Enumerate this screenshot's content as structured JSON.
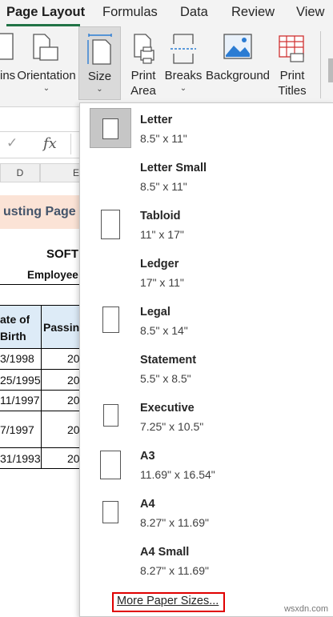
{
  "tabs": [
    {
      "label": "Page Layout",
      "active": true
    },
    {
      "label": "Formulas",
      "active": false
    },
    {
      "label": "Data",
      "active": false
    },
    {
      "label": "Review",
      "active": false
    },
    {
      "label": "View",
      "active": false
    }
  ],
  "ribbon": {
    "margins": {
      "label": "ins"
    },
    "orientation": {
      "label": "Orientation"
    },
    "size": {
      "label": "Size"
    },
    "print_area": {
      "line1": "Print",
      "line2": "Area"
    },
    "breaks": {
      "label": "Breaks"
    },
    "background": {
      "label": "Background"
    },
    "print_titles": {
      "line1": "Print",
      "line2": "Titles"
    }
  },
  "formula_bar": {
    "fx": "fx",
    "check": "✓"
  },
  "sheet": {
    "columns": [
      "D",
      "E"
    ],
    "title_partial": "usting Page S",
    "soft_partial": "SOFT",
    "employee_partial": "Employee",
    "header_date_line1": "ate of",
    "header_date_line2": "Birth",
    "header_passing_partial": "Passing",
    "rows": [
      {
        "date": "3/1998",
        "other": "20"
      },
      {
        "date": "25/1995",
        "other": "20"
      },
      {
        "date": "11/1997",
        "other": "20"
      },
      {
        "date": "7/1997",
        "other": "20"
      },
      {
        "date": "31/1993",
        "other": "20"
      }
    ]
  },
  "paper_sizes": [
    {
      "name": "Letter",
      "dims": "8.5\" x 11\"",
      "selected": true
    },
    {
      "name": "Letter Small",
      "dims": "8.5\" x 11\"",
      "selected": false
    },
    {
      "name": "Tabloid",
      "dims": "11\" x 17\"",
      "selected": false
    },
    {
      "name": "Ledger",
      "dims": "17\" x 11\"",
      "selected": false
    },
    {
      "name": "Legal",
      "dims": "8.5\" x 14\"",
      "selected": false
    },
    {
      "name": "Statement",
      "dims": "5.5\" x 8.5\"",
      "selected": false
    },
    {
      "name": "Executive",
      "dims": "7.25\" x 10.5\"",
      "selected": false
    },
    {
      "name": "A3",
      "dims": "11.69\" x 16.54\"",
      "selected": false
    },
    {
      "name": "A4",
      "dims": "8.27\" x 11.69\"",
      "selected": false
    },
    {
      "name": "A4 Small",
      "dims": "8.27\" x 11.69\"",
      "selected": false
    }
  ],
  "more_paper_sizes": "More Paper Sizes...",
  "watermark": "wsxdn.com",
  "colors": {
    "accent": "#217346",
    "highlight_border": "#e00000",
    "title_fill": "#fbe3d6",
    "title_text": "#44546a",
    "header_fill": "#ddebf7"
  }
}
